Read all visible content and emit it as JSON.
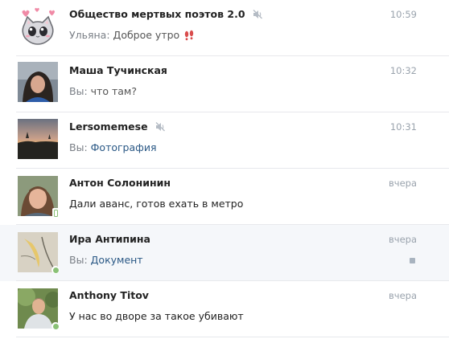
{
  "dialogs": [
    {
      "name": "Общество мертвых поэтов 2.0",
      "muted": true,
      "time": "10:59",
      "sender": "Ульяна:",
      "text": "Доброе утро",
      "emoji": "footprints-icon",
      "avatar": "cat-sticker-avatar"
    },
    {
      "name": "Маша Тучинская",
      "muted": false,
      "time": "10:32",
      "sender": "Вы:",
      "text": "что там?",
      "avatar": "photo-avatar"
    },
    {
      "name": "Lersomemese",
      "muted": true,
      "time": "10:31",
      "sender": "Вы:",
      "attachment": "Фотография",
      "avatar": "sunset-photo-avatar"
    },
    {
      "name": "Антон Солонинин",
      "muted": false,
      "time": "вчера",
      "text": "Дали аванс, готов ехать в метро",
      "status": "online-mobile",
      "avatar": "photo-avatar"
    },
    {
      "name": "Ира Антипина",
      "muted": false,
      "time": "вчера",
      "sender": "Вы:",
      "attachment": "Документ",
      "status": "online",
      "unread": true,
      "highlighted": true,
      "avatar": "sketch-photo-avatar"
    },
    {
      "name": "Anthony Titov",
      "muted": false,
      "time": "вчера",
      "text": "У нас во дворе за такое убивают",
      "status": "online",
      "avatar": "photo-avatar"
    }
  ],
  "colors": {
    "name": "#222222",
    "text": "#555555",
    "link": "#2a5885",
    "time": "#9aa3ad",
    "online": "#8ac176",
    "divider": "#e7e8ec",
    "highlight": "#f5f7fa"
  }
}
